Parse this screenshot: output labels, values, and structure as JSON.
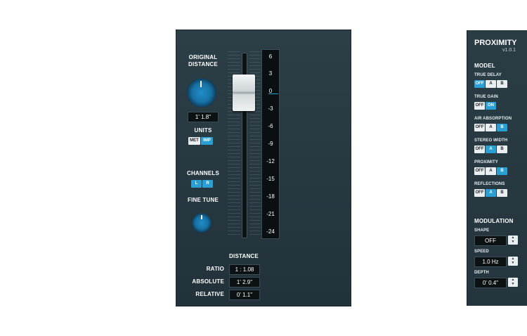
{
  "plugin": {
    "name": "PROXIMITY",
    "version": "v1.0.1"
  },
  "left": {
    "original_distance": {
      "label_line1": "ORIGINAL",
      "label_line2": "DISTANCE",
      "value": "1' 1.8\""
    },
    "units": {
      "label": "UNITS",
      "options": [
        "MET",
        "IMP"
      ],
      "selected": "IMP"
    },
    "channels": {
      "label": "CHANNELS",
      "options": [
        "L",
        "R"
      ],
      "selected": [
        "L",
        "R"
      ]
    },
    "fine_tune": {
      "label": "FINE TUNE"
    }
  },
  "meter": {
    "ticks": [
      "6",
      "3",
      "0",
      "-3",
      "-6",
      "-9",
      "-12",
      "-15",
      "-18",
      "-21",
      "-24"
    ]
  },
  "distance": {
    "header": "DISTANCE",
    "rows": [
      {
        "label": "RATIO",
        "value": "1 : 1.08"
      },
      {
        "label": "ABSOLUTE",
        "value": "1' 2.9\""
      },
      {
        "label": "RELATIVE",
        "value": "0' 1.1\""
      }
    ]
  },
  "model": {
    "header": "MODEL",
    "rows": [
      {
        "label": "TRUE DELAY",
        "options": [
          "OFF",
          "A",
          "B"
        ],
        "selected": "OFF"
      },
      {
        "label": "TRUE GAIN",
        "options": [
          "OFF",
          "ON"
        ],
        "selected": "ON"
      },
      {
        "label": "AIR ABSORPTION",
        "options": [
          "OFF",
          "A",
          "B"
        ],
        "selected": "B"
      },
      {
        "label": "STEREO WIDTH",
        "options": [
          "OFF",
          "A",
          "B"
        ],
        "selected": "A"
      },
      {
        "label": "PROXIMITY",
        "options": [
          "OFF",
          "A",
          "B"
        ],
        "selected": "B"
      },
      {
        "label": "REFLECTIONS",
        "options": [
          "OFF",
          "A",
          "B"
        ],
        "selected": "A"
      }
    ]
  },
  "modulation": {
    "header": "MODULATION",
    "rows": [
      {
        "label": "SHAPE",
        "value": "OFF"
      },
      {
        "label": "SPEED",
        "value": "1.0 Hz"
      },
      {
        "label": "DEPTH",
        "value": "0' 0.4\""
      }
    ]
  },
  "colors": {
    "accent": "#2a9fd4",
    "panel": "#2c3e46",
    "display": "#0c1114"
  }
}
